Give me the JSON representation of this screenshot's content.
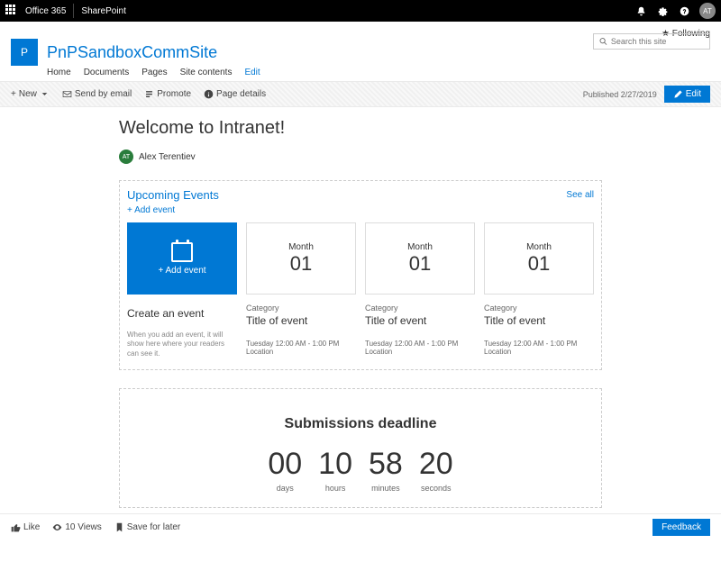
{
  "topbar": {
    "office": "Office 365",
    "app": "SharePoint",
    "avatar": "AT"
  },
  "site": {
    "following": "Following",
    "logo": "P",
    "title": "PnPSandboxCommSite",
    "nav": {
      "home": "Home",
      "documents": "Documents",
      "pages": "Pages",
      "contents": "Site contents",
      "edit": "Edit"
    },
    "search_placeholder": "Search this site"
  },
  "cmdbar": {
    "new": "New",
    "send": "Send by email",
    "promote": "Promote",
    "details": "Page details",
    "published": "Published 2/27/2019",
    "edit": "Edit"
  },
  "page": {
    "title": "Welcome to Intranet!",
    "author_initials": "AT",
    "author": "Alex Terentiev"
  },
  "events": {
    "heading": "Upcoming Events",
    "see_all": "See all",
    "add": "+ Add event",
    "create_tile": "+ Add event",
    "create_title": "Create an event",
    "create_desc": "When you add an event, it will show here where your readers can see it.",
    "items": [
      {
        "month": "Month",
        "day": "01",
        "category": "Category",
        "title": "Title of event",
        "time": "Tuesday 12:00 AM - 1:00 PM",
        "loc": "Location"
      },
      {
        "month": "Month",
        "day": "01",
        "category": "Category",
        "title": "Title of event",
        "time": "Tuesday 12:00 AM - 1:00 PM",
        "loc": "Location"
      },
      {
        "month": "Month",
        "day": "01",
        "category": "Category",
        "title": "Title of event",
        "time": "Tuesday 12:00 AM - 1:00 PM",
        "loc": "Location"
      }
    ]
  },
  "countdown": {
    "title": "Submissions deadline",
    "days": "00",
    "days_lbl": "days",
    "hours": "10",
    "hours_lbl": "hours",
    "minutes": "58",
    "minutes_lbl": "minutes",
    "seconds": "20",
    "seconds_lbl": "seconds"
  },
  "footer": {
    "like": "Like",
    "views": "10 Views",
    "save": "Save for later",
    "feedback": "Feedback"
  }
}
